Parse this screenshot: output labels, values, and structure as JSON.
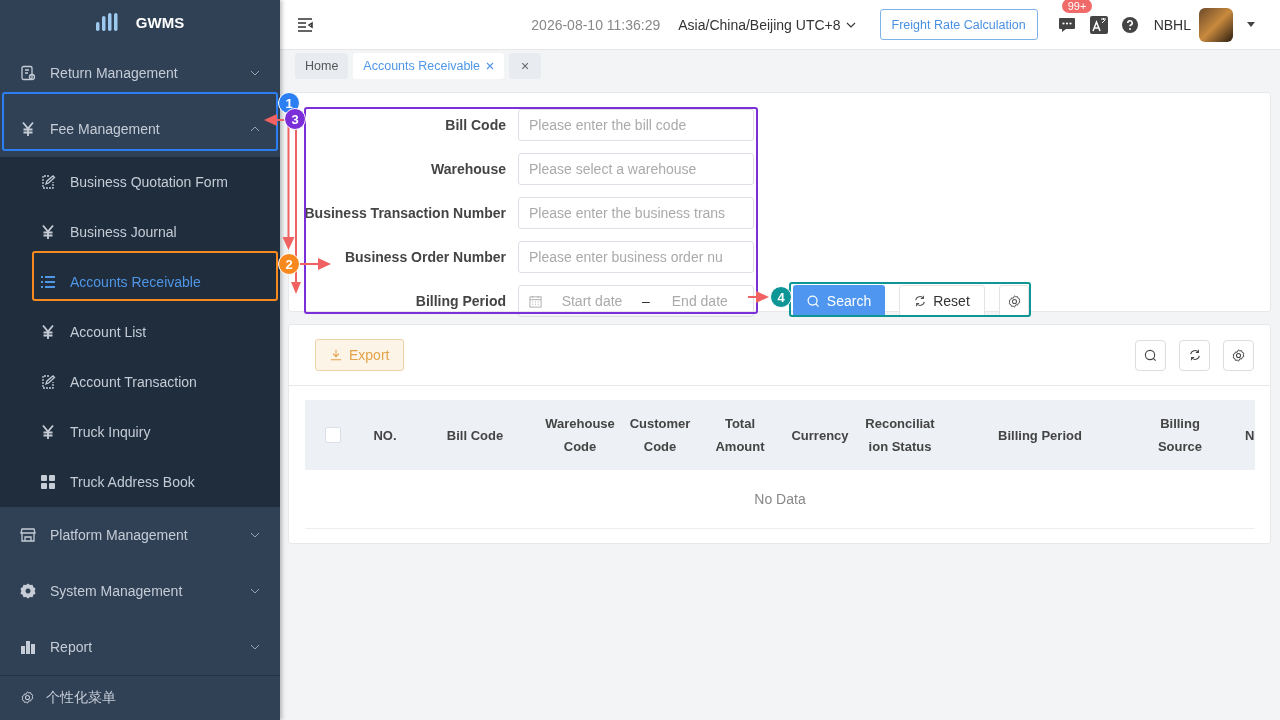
{
  "sidebar": {
    "logo": "GWMS",
    "menu": [
      {
        "label": "Return Management",
        "kind": "doc",
        "expanded": false
      },
      {
        "label": "Fee Management",
        "kind": "yen",
        "expanded": true,
        "children": [
          {
            "label": "Business Quotation Form",
            "kind": "edit",
            "selected": false
          },
          {
            "label": "Business Journal",
            "kind": "yen",
            "selected": false
          },
          {
            "label": "Accounts Receivable",
            "kind": "list",
            "selected": true
          },
          {
            "label": "Account List",
            "kind": "yen",
            "selected": false
          },
          {
            "label": "Account Transaction",
            "kind": "edit",
            "selected": false
          },
          {
            "label": "Truck Inquiry",
            "kind": "yen",
            "selected": false
          },
          {
            "label": "Truck Address Book",
            "kind": "grid",
            "selected": false
          }
        ]
      },
      {
        "label": "Platform Management",
        "kind": "store",
        "expanded": false
      },
      {
        "label": "System Management",
        "kind": "gear",
        "expanded": false
      },
      {
        "label": "Report",
        "kind": "chart",
        "expanded": false
      }
    ],
    "footer": "个性化菜单"
  },
  "header": {
    "datetime": "2026-08-10 11:36:29",
    "timezone": "Asia/China/Beijing UTC+8",
    "freight_button": "Freight Rate Calculation",
    "message_badge": "99+",
    "user": "NBHL"
  },
  "tabs": [
    {
      "label": "Home",
      "selected": false,
      "closable": false
    },
    {
      "label": "Accounts Receivable",
      "selected": true,
      "closable": true
    }
  ],
  "close_all": "×",
  "filters": [
    {
      "label": "Bill Code",
      "kind": "input",
      "placeholder": "Please enter the bill code"
    },
    {
      "label": "Warehouse",
      "kind": "select",
      "placeholder": "Please select a warehouse"
    },
    {
      "label": "Business Transaction Number",
      "kind": "input",
      "placeholder": "Please enter the business trans"
    },
    {
      "label": "Business Order Number",
      "kind": "input",
      "placeholder": "Please enter business order nu"
    },
    {
      "label": "Billing Period",
      "kind": "daterange",
      "start_placeholder": "Start date",
      "separator": "–",
      "end_placeholder": "End date"
    }
  ],
  "search_button": "Search",
  "reset_button": "Reset",
  "export_button": "Export",
  "table": {
    "select_all_checked": false,
    "columns": [
      "NO.",
      "Bill Code",
      "Warehouse Code",
      "Customer Code",
      "Total Amount",
      "Currency",
      "Reconciliation Status",
      "Billing Period",
      "Billing Source",
      "N"
    ],
    "empty_text": "No Data"
  },
  "annotations": [
    {
      "number": "1",
      "color": "#2b7ff2"
    },
    {
      "number": "2",
      "color": "#f7891f"
    },
    {
      "number": "3",
      "color": "#7a2fd8"
    },
    {
      "number": "4",
      "color": "#0e9595"
    }
  ]
}
